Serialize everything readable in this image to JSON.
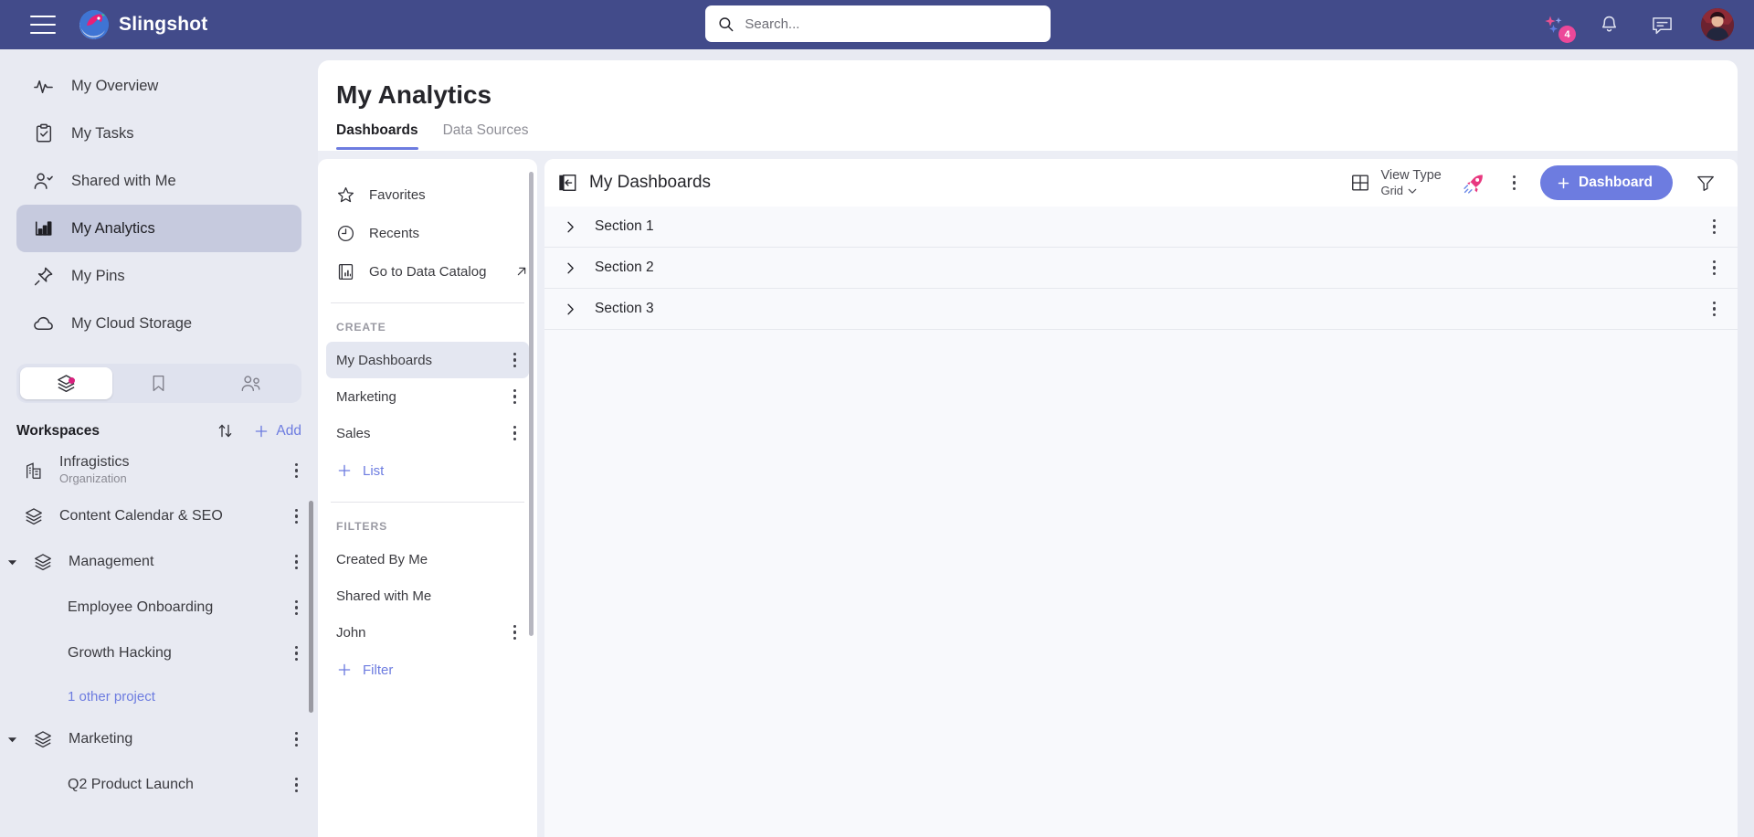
{
  "app": {
    "brand_name": "Slingshot",
    "accent": "#6d7ce0",
    "header_bg": "#424b8a",
    "pink": "#ec4899"
  },
  "topbar": {
    "menu_icon": "hamburger-icon",
    "logo_icon": "slingshot-rocket-logo",
    "search": {
      "placeholder": "Search...",
      "value": "",
      "icon": "search-icon"
    },
    "ai_icon": "sparkles-icon",
    "ai_badge": "4",
    "notifications_icon": "bell-icon",
    "messages_icon": "chat-icon",
    "avatar": "user-avatar"
  },
  "sidebar": {
    "nav": [
      {
        "label": "My Overview",
        "icon": "activity-pulse-icon",
        "active": false
      },
      {
        "label": "My Tasks",
        "icon": "clipboard-check-icon",
        "active": false
      },
      {
        "label": "Shared with Me",
        "icon": "person-check-icon",
        "active": false
      },
      {
        "label": "My Analytics",
        "icon": "bar-chart-icon",
        "active": true
      },
      {
        "label": "My Pins",
        "icon": "pin-icon",
        "active": false
      },
      {
        "label": "My Cloud Storage",
        "icon": "cloud-icon",
        "active": false
      }
    ],
    "segments": [
      {
        "icon": "layers-icon",
        "active": true,
        "dot": true
      },
      {
        "icon": "bookmark-icon",
        "active": false,
        "dot": false
      },
      {
        "icon": "people-icon",
        "active": false,
        "dot": false
      }
    ],
    "workspaces_title": "Workspaces",
    "sort_icon": "sort-arrows-icon",
    "add_label": "Add",
    "add_icon": "plus-icon",
    "items": [
      {
        "name": "Infragistics",
        "sub": "Organization",
        "icon": "building-icon",
        "kebab": true,
        "type": "org"
      },
      {
        "name": "Content Calendar & SEO",
        "sub": "",
        "icon": "layers-icon",
        "kebab": true,
        "type": "workspace"
      },
      {
        "name": "Management",
        "sub": "",
        "icon": "layers-icon",
        "kebab": true,
        "type": "workspace-expanded"
      },
      {
        "name": "Employee Onboarding",
        "sub": "",
        "icon": "",
        "kebab": true,
        "type": "project"
      },
      {
        "name": "Growth Hacking",
        "sub": "",
        "icon": "",
        "kebab": true,
        "type": "project"
      },
      {
        "name": "1 other project",
        "sub": "",
        "icon": "",
        "kebab": false,
        "type": "link"
      },
      {
        "name": "Marketing",
        "sub": "",
        "icon": "layers-icon",
        "kebab": true,
        "type": "workspace-expanded"
      },
      {
        "name": "Q2 Product Launch",
        "sub": "",
        "icon": "",
        "kebab": true,
        "type": "project"
      }
    ]
  },
  "main": {
    "page_title": "My Analytics",
    "tabs": [
      {
        "label": "Dashboards",
        "active": true
      },
      {
        "label": "Data Sources",
        "active": false
      }
    ]
  },
  "list_panel": {
    "quick": [
      {
        "label": "Favorites",
        "icon": "star-icon",
        "external": false
      },
      {
        "label": "Recents",
        "icon": "clock-icon",
        "external": false
      },
      {
        "label": "Go to Data Catalog",
        "icon": "data-catalog-icon",
        "external": true
      }
    ],
    "create_header": "CREATE",
    "create_items": [
      {
        "label": "My Dashboards",
        "selected": true,
        "kebab": true
      },
      {
        "label": "Marketing",
        "selected": false,
        "kebab": true
      },
      {
        "label": "Sales",
        "selected": false,
        "kebab": true
      }
    ],
    "add_list_label": "List",
    "filters_header": "FILTERS",
    "filter_items": [
      {
        "label": "Created By Me",
        "kebab": false
      },
      {
        "label": "Shared with Me",
        "kebab": false
      },
      {
        "label": "John",
        "kebab": true
      }
    ],
    "add_filter_label": "Filter"
  },
  "dashboards": {
    "collapse_icon": "collapse-panel-icon",
    "title": "My Dashboards",
    "view_type_label": "View Type",
    "view_type_value": "Grid",
    "view_type_icon": "grid-icon",
    "rocket_icon": "rocket-icon",
    "more_icon": "kebab-menu-icon",
    "new_button_label": "Dashboard",
    "new_button_icon": "plus-icon",
    "filter_icon": "funnel-icon",
    "sections": [
      {
        "label": "Section 1",
        "expanded": false
      },
      {
        "label": "Section 2",
        "expanded": false
      },
      {
        "label": "Section 3",
        "expanded": false
      }
    ]
  }
}
